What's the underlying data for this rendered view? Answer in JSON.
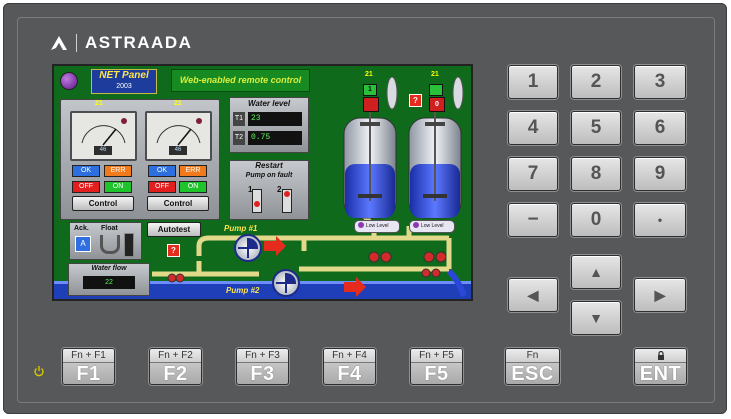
{
  "brand": {
    "name": "ASTRAADA"
  },
  "screen": {
    "title_main": "NET Panel",
    "title_year": "2003",
    "banner": "Web-enabled remote control",
    "gauge1": {
      "temp": "21",
      "value": "46"
    },
    "gauge2": {
      "temp": "21",
      "value": "46"
    },
    "ok_label": "OK",
    "err_label": "ERR",
    "off_label": "OFF",
    "on_label": "ON",
    "control_label": "Control",
    "water_level": {
      "title": "Water level",
      "t1_label": "T1",
      "t1_value": "23",
      "t2_label": "T2",
      "t2_value": "0.75"
    },
    "restart": {
      "line1": "Restart",
      "line2": "Pump on fault",
      "switch1": "1",
      "switch2": "2"
    },
    "ack_label": "Ack.",
    "ack_key": "A",
    "float_label": "Float",
    "autotest_label": "Autotest",
    "pump1_label": "Pump #1",
    "pump2_label": "Pump #2",
    "water_flow": {
      "title": "Water flow",
      "value": "22"
    },
    "tank1": {
      "temp": "21",
      "valve_state": "1",
      "low_level": "Low Level"
    },
    "tank2": {
      "temp": "21",
      "valve_state": "0",
      "low_level": "Low Level"
    },
    "alarm_symbol": "?"
  },
  "keypad": {
    "keys": [
      "1",
      "2",
      "3",
      "4",
      "5",
      "6",
      "7",
      "8",
      "9",
      "−",
      "0",
      "•"
    ],
    "arrows": {
      "up": "▲",
      "down": "▼",
      "left": "◀",
      "right": "▶"
    }
  },
  "function_keys": [
    {
      "sub": "Fn + F1",
      "main": "F1"
    },
    {
      "sub": "Fn + F2",
      "main": "F2"
    },
    {
      "sub": "Fn + F3",
      "main": "F3"
    },
    {
      "sub": "Fn + F4",
      "main": "F4"
    },
    {
      "sub": "Fn + F5",
      "main": "F5"
    },
    {
      "sub": "Fn",
      "main": "ESC"
    },
    {
      "sub": "",
      "main": "ENT"
    }
  ],
  "colors": {
    "bezel": "#56585a",
    "screen_bg": "#0f6a1c",
    "power_led": "#d7c600"
  }
}
